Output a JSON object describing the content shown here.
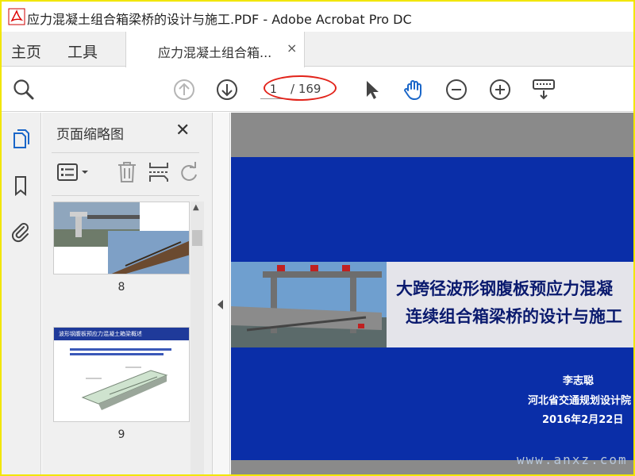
{
  "window": {
    "title": "应力混凝土组合箱梁桥的设计与施工.PDF - Adobe Acrobat Pro DC"
  },
  "tabs": {
    "home": "主页",
    "tools": "工具",
    "document": "应力混凝土组合箱...",
    "close": "×"
  },
  "toolbar": {
    "page_current": "1",
    "page_total": "/ 169"
  },
  "icons": {
    "toolbar": [
      "zoom-search-icon",
      "page-up-icon",
      "page-down-icon",
      "select-arrow-icon",
      "hand-tool-icon",
      "zoom-out-icon",
      "zoom-in-icon",
      "keyboard-icon"
    ],
    "leftnav": [
      "page-thumbnails-icon",
      "bookmark-icon",
      "attachment-icon"
    ],
    "panel": [
      "thumbnail-options-icon",
      "delete-icon",
      "insert-page-icon",
      "rotate-icon"
    ]
  },
  "thumbnails_panel": {
    "title": "页面缩略图",
    "close": "✕",
    "pages": [
      {
        "number": "8"
      },
      {
        "number": "9",
        "heading": "波形钢腹板预应力混凝土箱梁概述"
      }
    ]
  },
  "slide": {
    "title_line1": "大跨径波形钢腹板预应力混凝",
    "title_line2": "连续组合箱梁桥的设计与施工",
    "author": "李志聪",
    "organization": "河北省交通规划设计院",
    "date": "2016年2月22日"
  },
  "watermark": "www.anxz.com",
  "colors": {
    "frame": "#f2e600",
    "slide_blue": "#0a2ea8",
    "annotation_red": "#e2231a",
    "hand_tool_blue": "#1a66c8"
  }
}
